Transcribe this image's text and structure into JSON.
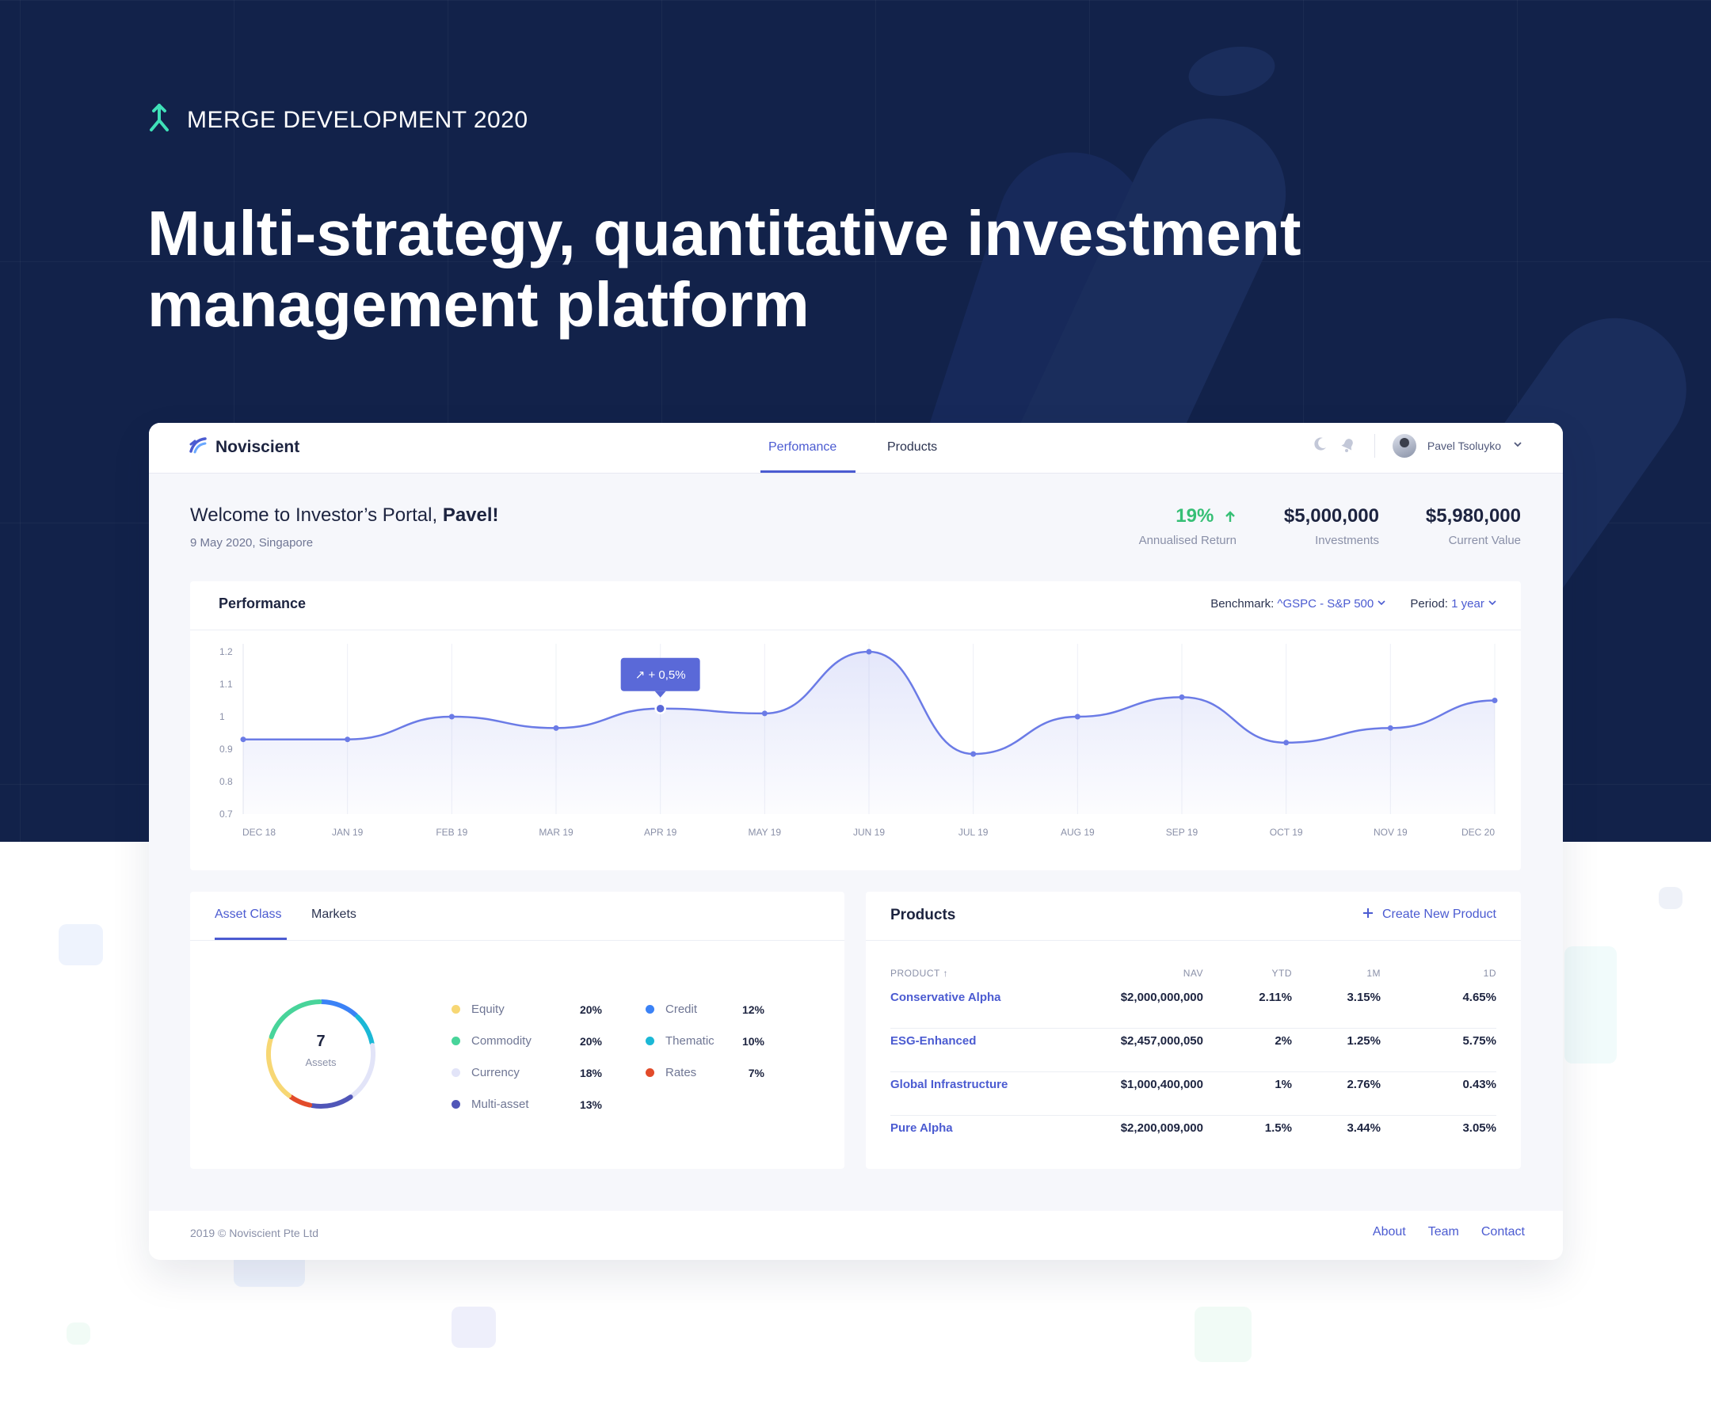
{
  "header": {
    "brand": "MERGE DEVELOPMENT 2020",
    "title": "Multi-strategy, quantitative investment management platform"
  },
  "app": {
    "logo_name": "Noviscient",
    "nav": {
      "tabs": [
        {
          "label": "Perfomance",
          "active": true
        },
        {
          "label": "Products",
          "active": false
        }
      ]
    },
    "user": {
      "name": "Pavel Tsoluyko"
    },
    "icons": {
      "theme": "moon-icon",
      "notifications": "bell-icon",
      "dropdown": "chevron-down-icon"
    }
  },
  "welcome": {
    "greeting": "Welcome to Investor’s Portal,",
    "name": "Pavel!",
    "subline": "9 May 2020, Singapore"
  },
  "stats": [
    {
      "value": "19%",
      "label": "Annualised Return",
      "trend": "up",
      "color": "#36bf75"
    },
    {
      "value": "$5,000,000",
      "label": "Investments"
    },
    {
      "value": "$5,980,000",
      "label": "Current Value"
    }
  ],
  "performance": {
    "title": "Performance",
    "benchmark_label": "Benchmark:",
    "benchmark_value": "^GSPC - S&P 500",
    "period_label": "Period:",
    "period_value": "1 year"
  },
  "chart_data": {
    "type": "area",
    "title": "",
    "x": [
      "DEC 18",
      "JAN 19",
      "FEB 19",
      "MAR 19",
      "APR 19",
      "MAY 19",
      "JUN 19",
      "JUL 19",
      "AUG 19",
      "SEP 19",
      "OCT 19",
      "NOV 19",
      "DEC 20"
    ],
    "y_ticks": [
      "1.2",
      "1.1",
      "1",
      "0.9",
      "0.8",
      "0.7"
    ],
    "ylim": [
      0.7,
      1.2
    ],
    "series": [
      {
        "values": [
          0.93,
          0.93,
          1.0,
          0.965,
          1.025,
          1.01,
          1.2,
          0.885,
          1.0,
          1.06,
          0.92,
          0.965,
          1.05
        ]
      }
    ],
    "tooltip": {
      "index": 4,
      "text": "↗ + 0,5%"
    },
    "grid": true,
    "accent": "#6b7be6"
  },
  "asset_panel": {
    "tabs": [
      {
        "label": "Asset Class",
        "active": true
      },
      {
        "label": "Markets",
        "active": false
      }
    ],
    "count": "7",
    "count_label": "Assets",
    "legend": [
      {
        "label": "Equity",
        "pct": "20%",
        "color": "#f7d774"
      },
      {
        "label": "Commodity",
        "pct": "20%",
        "color": "#48d49a"
      },
      {
        "label": "Currency",
        "pct": "18%",
        "color": "#e2e4f8"
      },
      {
        "label": "Multi-asset",
        "pct": "13%",
        "color": "#5056b8"
      },
      {
        "label": "Credit",
        "pct": "12%",
        "color": "#3b82f6"
      },
      {
        "label": "Thematic",
        "pct": "10%",
        "color": "#1bb8d6"
      },
      {
        "label": "Rates",
        "pct": "7%",
        "color": "#e24b2a"
      }
    ]
  },
  "products": {
    "title": "Products",
    "create_label": "Create New Product",
    "columns": [
      "PRODUCT ↑",
      "NAV",
      "YTD",
      "1M",
      "1D"
    ],
    "rows": [
      {
        "name": "Conservative Alpha",
        "nav": "$2,000,000,000",
        "ytd": "2.11%",
        "m1": "3.15%",
        "d1": "4.65%"
      },
      {
        "name": "ESG-Enhanced",
        "nav": "$2,457,000,050",
        "ytd": "2%",
        "m1": "1.25%",
        "d1": "5.75%"
      },
      {
        "name": "Global Infrastructure",
        "nav": "$1,000,400,000",
        "ytd": "1%",
        "m1": "2.76%",
        "d1": "0.43%"
      },
      {
        "name": "Pure Alpha",
        "nav": "$2,200,009,000",
        "ytd": "1.5%",
        "m1": "3.44%",
        "d1": "3.05%"
      }
    ]
  },
  "footer": {
    "copyright": "2019 © Noviscient Pte Ltd",
    "links": [
      "About",
      "Team",
      "Contact"
    ]
  }
}
